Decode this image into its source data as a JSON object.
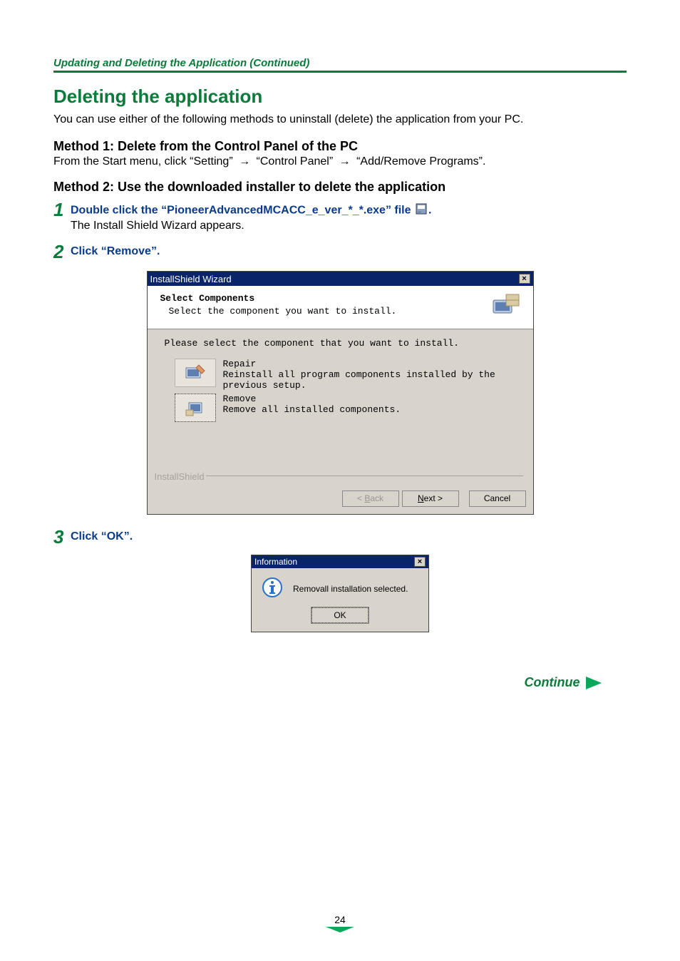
{
  "header": {
    "section": "Updating and Deleting the Application (Continued)"
  },
  "title": "Deleting the application",
  "intro": "You can use either of the following methods to uninstall (delete) the application from your PC.",
  "method1": {
    "title": "Method 1: Delete from the Control Panel of the PC",
    "lead": "From the Start menu, click ",
    "p1": "“Setting”",
    "p2": "“Control Panel”",
    "p3": "“Add/Remove Programs”.",
    "arrow": "→"
  },
  "method2": {
    "title": "Method 2: Use the downloaded installer to delete the application"
  },
  "steps": {
    "s1": {
      "num": "1",
      "title_pre": "Double click the “PioneerAdvancedMCACC_e_ver_*_*.exe” file ",
      "title_post": ".",
      "sub": "The Install Shield Wizard appears."
    },
    "s2": {
      "num": "2",
      "title": "Click “Remove”."
    },
    "s3": {
      "num": "3",
      "title": "Click “OK”."
    }
  },
  "wizard": {
    "title": "InstallShield Wizard",
    "header_title": "Select Components",
    "header_sub": "Select the component you want to install.",
    "instruction": "Please select the component that you want to install.",
    "options": {
      "repair": {
        "title": "Repair",
        "desc": "Reinstall all program components installed by the previous setup."
      },
      "remove": {
        "title": "Remove",
        "desc": "Remove all installed components."
      }
    },
    "brand": "InstallShield",
    "buttons": {
      "back_pre": "< ",
      "back_u": "B",
      "back_post": "ack",
      "next_u": "N",
      "next_post": "ext >",
      "cancel": "Cancel"
    },
    "close": "×"
  },
  "info": {
    "title": "Information",
    "message": "Removall installation selected.",
    "ok": "OK",
    "close": "×"
  },
  "continue_label": "Continue",
  "page_number": "24"
}
